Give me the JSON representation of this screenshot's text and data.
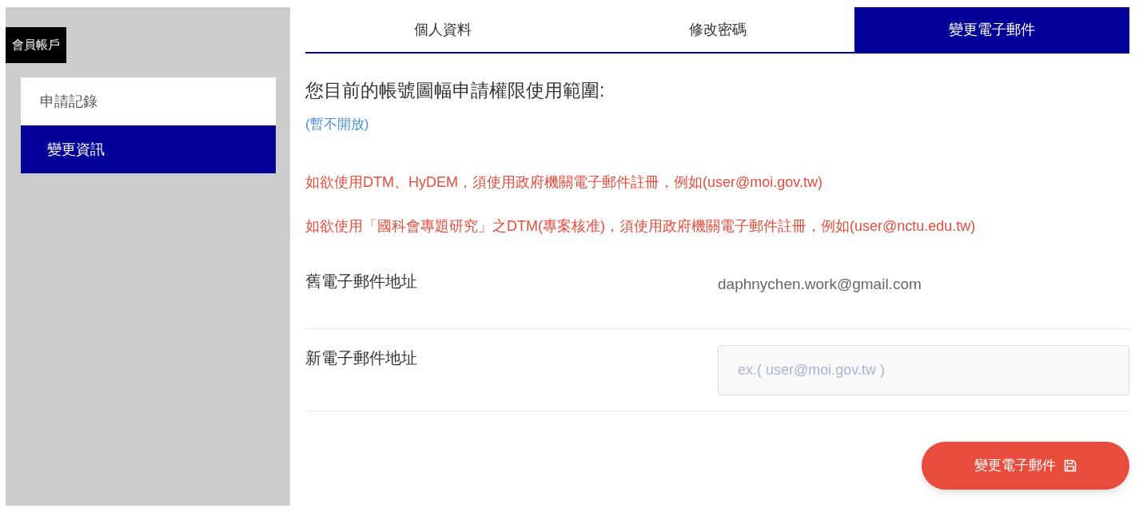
{
  "sidebar": {
    "title": "會員帳戶",
    "items": [
      {
        "label": "申請記錄",
        "selected": false
      },
      {
        "label": "變更資訊",
        "selected": true
      }
    ]
  },
  "tabs": [
    {
      "label": "個人資料",
      "selected": false
    },
    {
      "label": "修改密碼",
      "selected": false
    },
    {
      "label": "變更電子郵件",
      "selected": true
    }
  ],
  "content": {
    "heading": "您目前的帳號圖幅申請權限使用範圍:",
    "status": "(暫不開放)",
    "notices": [
      "如欲使用DTM、HyDEM，須使用政府機關電子郵件註冊，例如(user@moi.gov.tw)",
      "如欲使用「國科會專題研究」之DTM(專案核准)，須使用政府機關電子郵件註冊，例如(user@nctu.edu.tw)"
    ],
    "fields": [
      {
        "kind": "text",
        "label": "舊電子郵件地址",
        "value": "daphnychen.work@gmail.com"
      },
      {
        "kind": "input",
        "label": "新電子郵件地址",
        "placeholder": "ex.( user@moi.gov.tw )"
      }
    ],
    "submit_button": {
      "label": "變更電子郵件"
    }
  }
}
